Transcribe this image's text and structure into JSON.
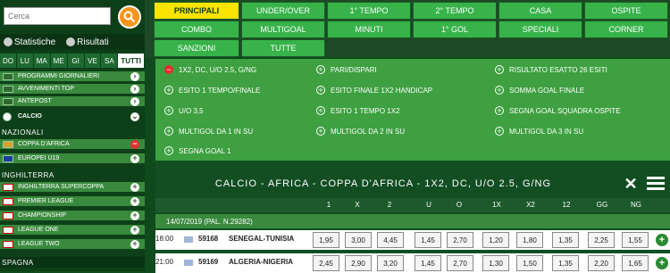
{
  "search": {
    "placeholder": "Cerca"
  },
  "stats": {
    "statistiche": "Statistiche",
    "risultati": "Risultati"
  },
  "days": [
    "DO",
    "LU",
    "MA",
    "ME",
    "GI",
    "VE",
    "SA",
    "TUTTI"
  ],
  "sidebar": {
    "items_top": [
      {
        "label": "PROGRAMMI GIORNALIERI"
      },
      {
        "label": "AVVENIMENTI TOP"
      },
      {
        "label": "ANTEPOST"
      },
      {
        "label": "CALCIO"
      }
    ],
    "nazionali_header": "NAZIONALI",
    "nazionali": [
      {
        "label": "COPPA D'AFRICA"
      },
      {
        "label": "EUROPEI U19"
      }
    ],
    "inghilterra_header": "INGHILTERRA",
    "inghilterra": [
      {
        "label": "INGHILTERRA SUPERCOPPA"
      },
      {
        "label": "PREMIER LEAGUE"
      },
      {
        "label": "CHAMPIONSHIP"
      },
      {
        "label": "LEAGUE ONE"
      },
      {
        "label": "LEAGUE TWO"
      }
    ],
    "spagna_header": "SPAGNA"
  },
  "menu": [
    {
      "label": "PRINCIPALI",
      "active": true
    },
    {
      "label": "UNDER/OVER"
    },
    {
      "label": "1° TEMPO"
    },
    {
      "label": "2° TEMPO"
    },
    {
      "label": "CASA"
    },
    {
      "label": "OSPITE"
    },
    {
      "label": "COMBO"
    },
    {
      "label": "MULTIGOAL"
    },
    {
      "label": "MINUTI"
    },
    {
      "label": "1° GOL"
    },
    {
      "label": "SPECIALI"
    },
    {
      "label": "CORNER"
    },
    {
      "label": "SANZIONI"
    },
    {
      "label": "TUTTE"
    }
  ],
  "markets": [
    "1X2, DC, U/O 2.5, G/NG",
    "PARI/DISPARI",
    "RISULTATO ESATTO 26 ESITI",
    "ESITO 1 TEMPO/FINALE",
    "ESITO FINALE 1X2 HANDICAP",
    "SOMMA GOAL FINALE",
    "U/O 3,5",
    "ESITO 1 TEMPO 1X2",
    "SEGNA GOAL SQUADRA OSPITE",
    "MULTIGOL DA 1 IN SU",
    "MULTIGOL DA 2 IN SU",
    "MULTIGOL DA 3 IN SU",
    "SEGNA GOAL 1"
  ],
  "event": {
    "title": "CALCIO - AFRICA - COPPA D'AFRICA - 1X2, DC, U/O 2.5, G/NG",
    "columns": [
      "1",
      "X",
      "2",
      "U",
      "O",
      "1X",
      "X2",
      "12",
      "GG",
      "NG"
    ],
    "date": "14/07/2019 (PAL. N.29282)",
    "matches": [
      {
        "time": "18:00",
        "code": "59168",
        "teams": "SENEGAL-TUNISIA",
        "odds": [
          "1,95",
          "3,00",
          "4,45",
          "1,45",
          "2,70",
          "1,20",
          "1,80",
          "1,35",
          "2,25",
          "1,55"
        ]
      },
      {
        "time": "21:00",
        "code": "59169",
        "teams": "ALGERIA-NIGERIA",
        "odds": [
          "2,45",
          "2,90",
          "3,20",
          "1,45",
          "2,70",
          "1,30",
          "1,50",
          "1,35",
          "2,20",
          "1,65"
        ]
      }
    ]
  },
  "colors": {
    "accent": "#f7941d",
    "menu_green": "#37b34a",
    "menu_active": "#fbe400"
  }
}
